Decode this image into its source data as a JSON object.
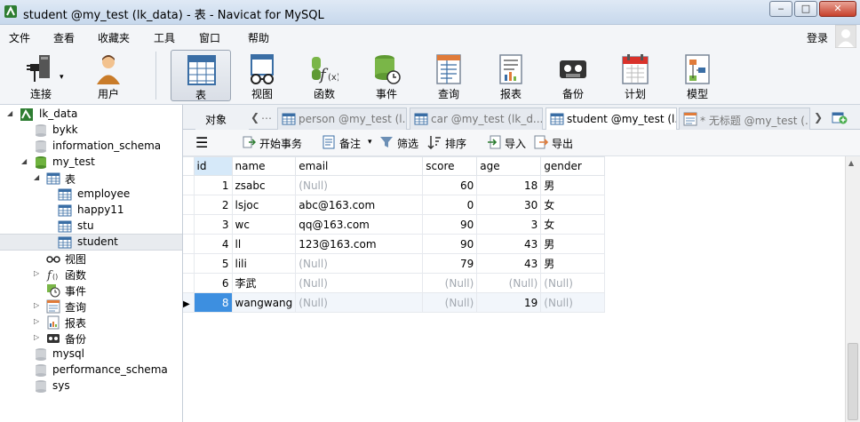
{
  "window": {
    "title": "student @my_test (lk_data) - 表 - Navicat for MySQL",
    "buttons": {
      "minimize": "‒",
      "maximize": "□",
      "close": "✕"
    }
  },
  "menu": {
    "items": [
      "文件",
      "查看",
      "收藏夹",
      "工具",
      "窗口",
      "帮助"
    ],
    "login": "登录"
  },
  "toolbar": {
    "buttons": [
      {
        "label": "连接",
        "icon": "connection-plug-icon"
      },
      {
        "label": "用户",
        "icon": "user-icon"
      },
      {
        "label": "表",
        "icon": "table-icon"
      },
      {
        "label": "视图",
        "icon": "view-glasses-icon"
      },
      {
        "label": "函数",
        "icon": "function-icon"
      },
      {
        "label": "事件",
        "icon": "event-clock-icon"
      },
      {
        "label": "查询",
        "icon": "query-icon"
      },
      {
        "label": "报表",
        "icon": "report-icon"
      },
      {
        "label": "备份",
        "icon": "backup-tape-icon"
      },
      {
        "label": "计划",
        "icon": "schedule-calendar-icon"
      },
      {
        "label": "模型",
        "icon": "model-icon"
      }
    ],
    "active": "表"
  },
  "sidebar": {
    "connection": "lk_data",
    "items": [
      {
        "label": "lk_data",
        "level": 0,
        "type": "connection",
        "expanded": true
      },
      {
        "label": "bykk",
        "level": 1,
        "type": "db"
      },
      {
        "label": "information_schema",
        "level": 1,
        "type": "db"
      },
      {
        "label": "my_test",
        "level": 1,
        "type": "db-open",
        "expanded": true
      },
      {
        "label": "表",
        "level": 2,
        "type": "tables",
        "expanded": true
      },
      {
        "label": "employee",
        "level": 3,
        "type": "table"
      },
      {
        "label": "happy11",
        "level": 3,
        "type": "table"
      },
      {
        "label": "stu",
        "level": 3,
        "type": "table"
      },
      {
        "label": "student",
        "level": 3,
        "type": "table",
        "selected": true
      },
      {
        "label": "视图",
        "level": 2,
        "type": "views"
      },
      {
        "label": "函数",
        "level": 2,
        "type": "functions",
        "collapsed": true
      },
      {
        "label": "事件",
        "level": 2,
        "type": "events"
      },
      {
        "label": "查询",
        "level": 2,
        "type": "queries",
        "collapsed": true
      },
      {
        "label": "报表",
        "level": 2,
        "type": "reports",
        "collapsed": true
      },
      {
        "label": "备份",
        "level": 2,
        "type": "backups",
        "collapsed": true
      },
      {
        "label": "mysql",
        "level": 1,
        "type": "db"
      },
      {
        "label": "performance_schema",
        "level": 1,
        "type": "db"
      },
      {
        "label": "sys",
        "level": 1,
        "type": "db"
      }
    ]
  },
  "tabs": {
    "objects_label": "对象",
    "items": [
      {
        "label": "person @my_test (l...",
        "active": false
      },
      {
        "label": "car @my_test (lk_d...",
        "active": false
      },
      {
        "label": "student @my_test (l...",
        "active": true
      },
      {
        "label": "* 无标题 @my_test (...",
        "active": false
      }
    ]
  },
  "object_toolbar": {
    "begin_tx": "开始事务",
    "note": "备注",
    "filter": "筛选",
    "sort": "排序",
    "import": "导入",
    "export": "导出"
  },
  "grid": {
    "columns": [
      "id",
      "name",
      "email",
      "score",
      "age",
      "gender"
    ],
    "rows": [
      [
        "1",
        "zsabc",
        "(Null)",
        "60",
        "18",
        "男"
      ],
      [
        "2",
        "lsjoc",
        "abc@163.com",
        "0",
        "30",
        "女"
      ],
      [
        "3",
        "wc",
        "qq@163.com",
        "90",
        "3",
        "女"
      ],
      [
        "4",
        "ll",
        "123@163.com",
        "90",
        "43",
        "男"
      ],
      [
        "5",
        "lili",
        "(Null)",
        "79",
        "43",
        "男"
      ],
      [
        "6",
        "李武",
        "(Null)",
        "(Null)",
        "(Null)",
        "(Null)"
      ],
      [
        "8",
        "wangwang",
        "(Null)",
        "(Null)",
        "19",
        "(Null)"
      ]
    ],
    "current_row_index": 6,
    "row_marker": "▶"
  },
  "colors": {
    "selection_blue": "#3d8fe0",
    "null_gray": "#a3a9b1",
    "header_highlight": "#d6e9f9"
  }
}
